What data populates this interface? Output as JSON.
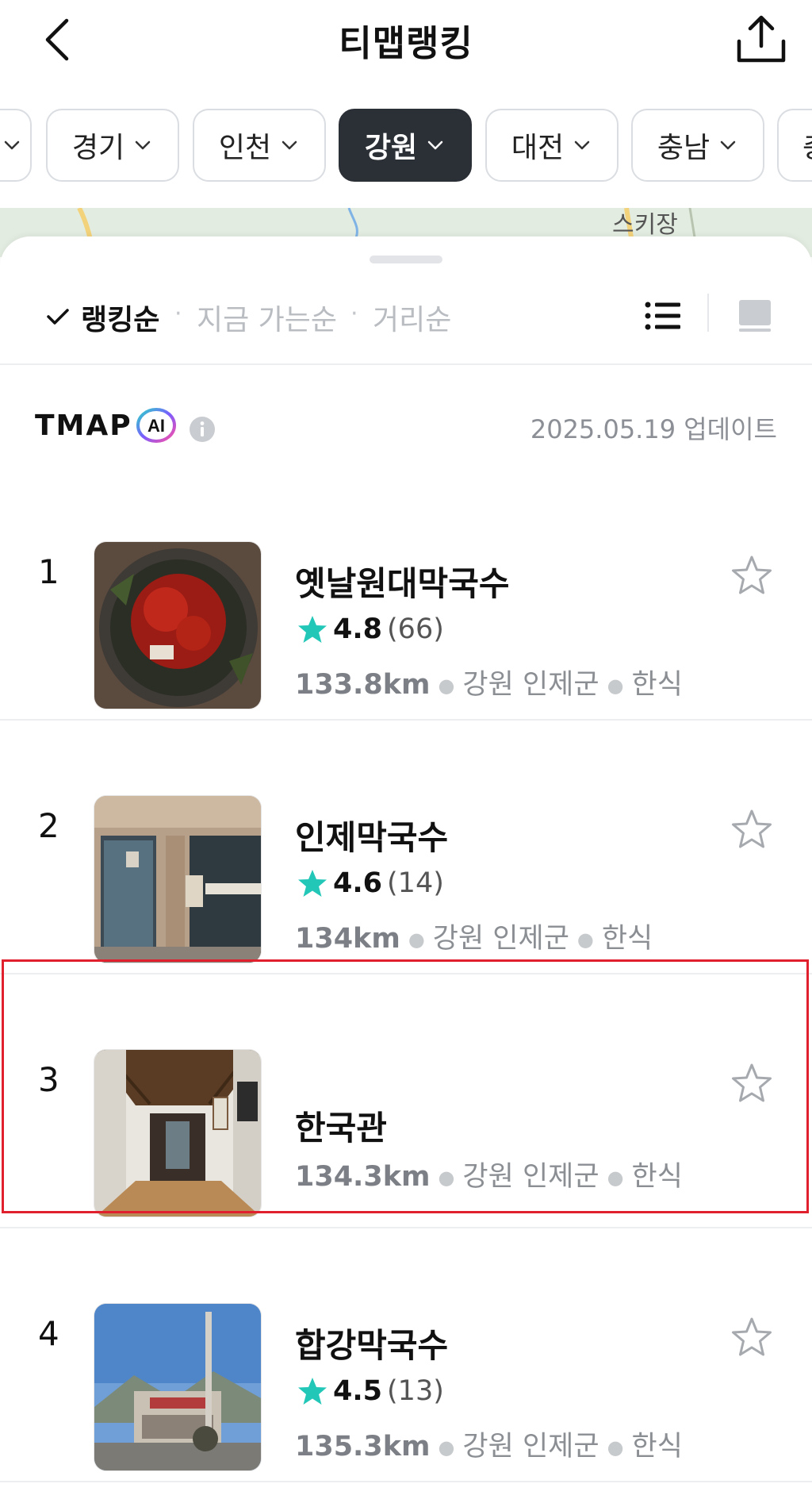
{
  "header": {
    "title": "티맵랭킹",
    "back_icon": "chevron-left-icon",
    "share_icon": "share-icon"
  },
  "regions": [
    {
      "label": "경기",
      "active": false
    },
    {
      "label": "인천",
      "active": false
    },
    {
      "label": "강원",
      "active": true
    },
    {
      "label": "대전",
      "active": false
    },
    {
      "label": "충남",
      "active": false
    },
    {
      "label": "충",
      "active": false
    }
  ],
  "map": {
    "label": "스키장"
  },
  "sort": {
    "active": "랭킹순",
    "option_now": "지금 가는순",
    "option_distance": "거리순",
    "separator": "·"
  },
  "ai": {
    "brand": "TMAP",
    "badge": "AI",
    "updated": "2025.05.19 업데이트"
  },
  "items": [
    {
      "rank": "1",
      "name": "옛날원대막국수",
      "rating": "4.8",
      "count": "(66)",
      "distance": "133.8km",
      "region": "강원 인제군",
      "category": "한식"
    },
    {
      "rank": "2",
      "name": "인제막국수",
      "rating": "4.6",
      "count": "(14)",
      "distance": "134km",
      "region": "강원 인제군",
      "category": "한식"
    },
    {
      "rank": "3",
      "name": "한국관",
      "rating": "",
      "count": "",
      "distance": "134.3km",
      "region": "강원 인제군",
      "category": "한식"
    },
    {
      "rank": "4",
      "name": "합강막국수",
      "rating": "4.5",
      "count": "(13)",
      "distance": "135.3km",
      "region": "강원 인제군",
      "category": "한식"
    }
  ],
  "colors": {
    "accent_star": "#22c7b8",
    "active_chip": "#2b2f36",
    "highlight": "#e0202c"
  }
}
